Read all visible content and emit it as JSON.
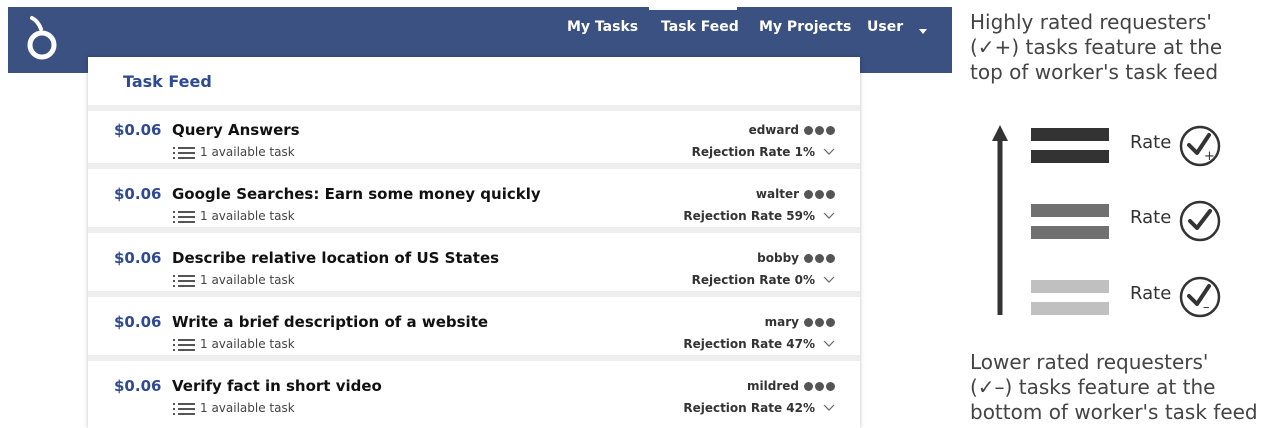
{
  "navbar": {
    "items": [
      {
        "label": "My Tasks"
      },
      {
        "label": "Task Feed",
        "active": true
      },
      {
        "label": "My Projects"
      },
      {
        "label": "User"
      }
    ],
    "background_color": "#3a5181"
  },
  "feed": {
    "title": "Task Feed",
    "tasks": [
      {
        "price": "$0.06",
        "title": "Query Answers",
        "available": "1 available task",
        "requester": "edward",
        "rejection": "Rejection Rate 1%"
      },
      {
        "price": "$0.06",
        "title": "Google Searches: Earn some money quickly",
        "available": "1 available task",
        "requester": "walter",
        "rejection": "Rejection Rate 59%"
      },
      {
        "price": "$0.06",
        "title": "Describe relative location of US States",
        "available": "1 available task",
        "requester": "bobby",
        "rejection": "Rejection Rate 0%"
      },
      {
        "price": "$0.06",
        "title": "Write a brief description of a website",
        "available": "1 available task",
        "requester": "mary",
        "rejection": "Rejection Rate 47%"
      },
      {
        "price": "$0.06",
        "title": "Verify fact in short video",
        "available": "1 available task",
        "requester": "mildred",
        "rejection": "Rejection Rate 42%"
      }
    ],
    "accent_color": "#2d4a93"
  },
  "annotation": {
    "top_text": [
      "Highly rated requesters'",
      "(✓+) tasks feature at the",
      "top of worker's task feed"
    ],
    "bottom_text": [
      "Lower rated requesters'",
      "(✓–) tasks feature at the",
      "bottom of worker's task feed"
    ],
    "rate_label_high": "Rate",
    "rate_label_mid": "Rate",
    "rate_label_low": "Rate",
    "rate_high_sign": "+",
    "rate_low_sign": "–"
  }
}
